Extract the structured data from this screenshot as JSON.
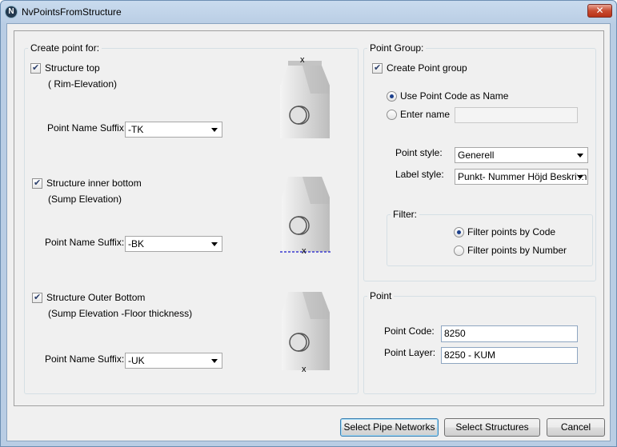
{
  "window": {
    "title": "NvPointsFromStructure",
    "close_label": "✕",
    "app_icon_letter": "N"
  },
  "create_point_for": {
    "legend": "Create point for:",
    "structure_top": {
      "label": "Structure top",
      "sublabel": "( Rim-Elevation)",
      "checked": true,
      "suffix_label": "Point Name Suffix:",
      "suffix_value": "-TK"
    },
    "structure_inner_bottom": {
      "label": "Structure inner bottom",
      "sublabel": "(Sump Elevation)",
      "checked": true,
      "suffix_label": "Point Name Suffix:",
      "suffix_value": "-BK"
    },
    "structure_outer_bottom": {
      "label": "Structure Outer Bottom",
      "sublabel": "(Sump Elevation -Floor thickness)",
      "checked": true,
      "suffix_label": "Point Name Suffix:",
      "suffix_value": "-UK"
    },
    "marker_glyph": "x"
  },
  "point_group": {
    "legend": "Point Group:",
    "create_group": {
      "label": "Create Point group",
      "checked": true
    },
    "use_code_as_name": {
      "label": "Use Point Code as Name",
      "selected": true
    },
    "enter_name": {
      "label": "Enter name",
      "selected": false,
      "value": ""
    },
    "point_style": {
      "label": "Point style:",
      "value": "Generell"
    },
    "label_style": {
      "label": "Label style:",
      "value": "Punkt- Nummer Höjd Beskrivning"
    },
    "filter": {
      "legend": "Filter:",
      "by_code": {
        "label": "Filter points by Code",
        "selected": true
      },
      "by_number": {
        "label": "Filter points by Number",
        "selected": false
      }
    }
  },
  "point": {
    "legend": "Point",
    "code": {
      "label": "Point Code:",
      "value": "8250"
    },
    "layer": {
      "label": "Point Layer:",
      "value": "8250 - KUM"
    }
  },
  "buttons": {
    "select_pipe_networks": "Select Pipe Networks",
    "select_structures": "Select Structures",
    "cancel": "Cancel"
  },
  "colors": {
    "highlight_dashed": "#3a3ad0",
    "default_button_border": "#3c7fb1"
  }
}
